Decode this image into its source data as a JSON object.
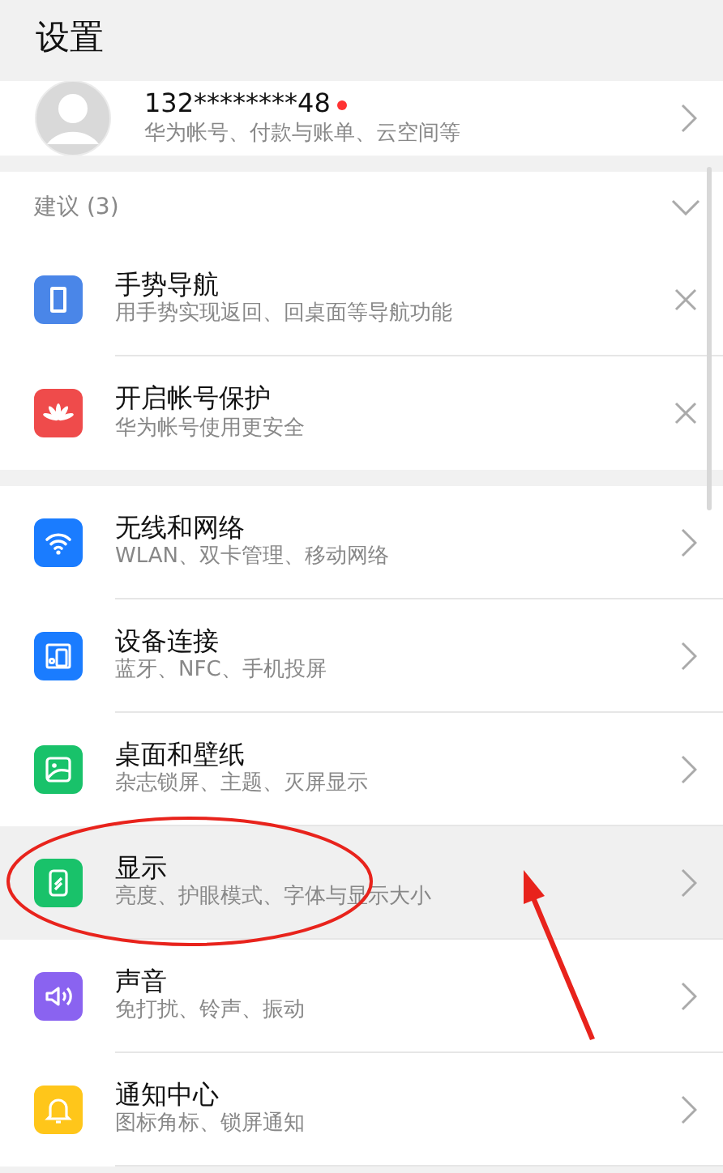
{
  "header": {
    "title": "设置"
  },
  "account": {
    "name": "132********48",
    "subtitle": "华为帐号、付款与账单、云空间等",
    "badge": true
  },
  "suggestions": {
    "title": "建议 (3)",
    "expanded": true,
    "items": [
      {
        "kind": "phone",
        "color": "#4a86e8",
        "title": "手势导航",
        "subtitle": "用手势实现返回、回桌面等导航功能"
      },
      {
        "kind": "flower",
        "color": "#ef4b4b",
        "title": "开启帐号保护",
        "subtitle": "华为帐号使用更安全"
      }
    ]
  },
  "settings": [
    {
      "kind": "wifi",
      "color": "#1a7cff",
      "title": "无线和网络",
      "subtitle": "WLAN、双卡管理、移动网络",
      "selected": false
    },
    {
      "kind": "devices",
      "color": "#1a7cff",
      "title": "设备连接",
      "subtitle": "蓝牙、NFC、手机投屏",
      "selected": false
    },
    {
      "kind": "image",
      "color": "#19c26a",
      "title": "桌面和壁纸",
      "subtitle": "杂志锁屏、主题、灭屏显示",
      "selected": false
    },
    {
      "kind": "display",
      "color": "#19c26a",
      "title": "显示",
      "subtitle": "亮度、护眼模式、字体与显示大小",
      "selected": true
    },
    {
      "kind": "sound",
      "color": "#8a63f0",
      "title": "声音",
      "subtitle": "免打扰、铃声、振动",
      "selected": false
    },
    {
      "kind": "bell",
      "color": "#ffc61a",
      "title": "通知中心",
      "subtitle": "图标角标、锁屏通知",
      "selected": false
    }
  ]
}
